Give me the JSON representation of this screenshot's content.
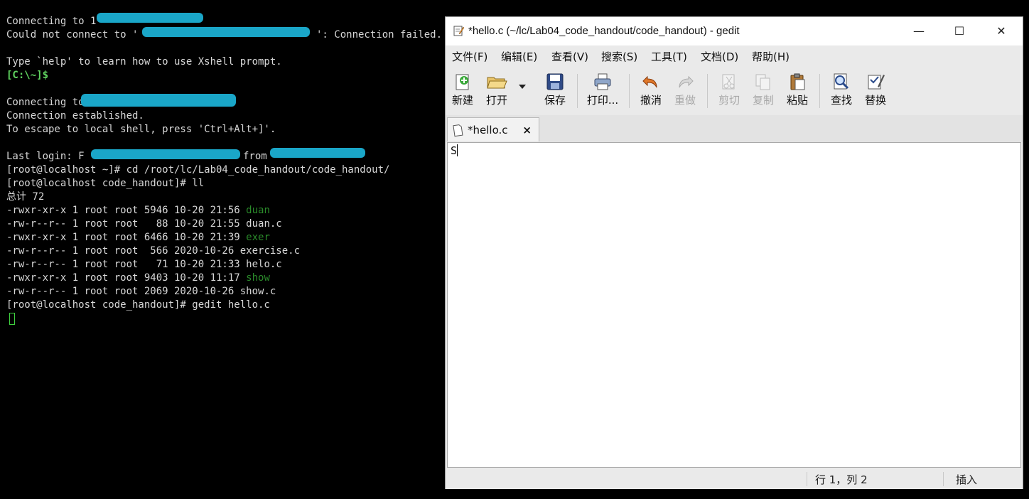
{
  "terminal": {
    "lines": [
      "Connecting to 1",
      "Could not connect to '",
      "': Connection failed.",
      "Type `help' to learn how to use Xshell prompt.",
      "[C:\\~]$",
      "Connecting to",
      "Connection established.",
      "To escape to local shell, press 'Ctrl+Alt+]'.",
      "Last login: F",
      "from",
      "[root@localhost ~]# cd /root/lc/Lab04_code_handout/code_handout/",
      "[root@localhost code_handout]# ll",
      "总计 72"
    ],
    "listing": [
      {
        "meta": "-rwxr-xr-x 1 root root 5946 10-20 21:56 ",
        "name": "duan",
        "exec": true
      },
      {
        "meta": "-rw-r--r-- 1 root root   88 10-20 21:55 ",
        "name": "duan.c",
        "exec": false
      },
      {
        "meta": "-rwxr-xr-x 1 root root 6466 10-20 21:39 ",
        "name": "exer",
        "exec": true
      },
      {
        "meta": "-rw-r--r-- 1 root root  566 2020-10-26 ",
        "name": "exercise.c",
        "exec": false
      },
      {
        "meta": "-rw-r--r-- 1 root root   71 10-20 21:33 ",
        "name": "helo.c",
        "exec": false
      },
      {
        "meta": "-rwxr-xr-x 1 root root 9403 10-20 11:17 ",
        "name": "show",
        "exec": true
      },
      {
        "meta": "-rw-r--r-- 1 root root 2069 2020-10-26 ",
        "name": "show.c",
        "exec": false
      }
    ],
    "last_command": "[root@localhost code_handout]# gedit hello.c"
  },
  "gedit": {
    "title": "*hello.c (~/lc/Lab04_code_handout/code_handout) - gedit",
    "window_buttons": {
      "minimize": "—",
      "maximize": "☐",
      "close": "✕"
    },
    "menu": [
      "文件(F)",
      "编辑(E)",
      "查看(V)",
      "搜索(S)",
      "工具(T)",
      "文档(D)",
      "帮助(H)"
    ],
    "toolbar": {
      "new": "新建",
      "open": "打开",
      "save": "保存",
      "print": "打印...",
      "undo": "撤消",
      "redo": "重做",
      "cut": "剪切",
      "copy": "复制",
      "paste": "粘贴",
      "find": "查找",
      "replace": "替换"
    },
    "tab": {
      "label": "*hello.c",
      "close": "×"
    },
    "editor": {
      "content": "S"
    },
    "status": {
      "position": "行 1，列 2",
      "mode": "插入"
    }
  },
  "colors": {
    "terminal_text": "#d7d7d7",
    "prompt_green": "#5fd35f",
    "exec_green": "#2a8a2a",
    "redaction": "#1aa6c8"
  }
}
